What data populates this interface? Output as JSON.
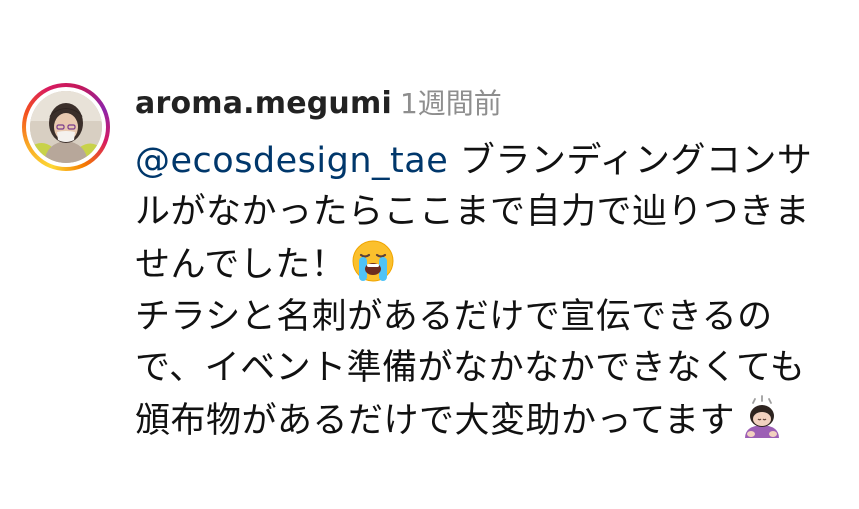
{
  "comment": {
    "username": "aroma.megumi",
    "timestamp": "1週間前",
    "mention": "@ecosdesign_tae",
    "paragraph1_text": " ブランディングコンサルがなかったらここまで自力で辿りつきませんでした！",
    "paragraph1_emoji": "loudly-crying-face",
    "paragraph2_text": "チラシと名刺があるだけで宣伝できるので、イベント準備がなかなかできなくても頒布物があるだけで大変助かってます",
    "paragraph2_emoji": "person-bowing"
  },
  "colors": {
    "mention": "#00376b",
    "timestamp": "#8e8e8e",
    "text": "#111111"
  }
}
